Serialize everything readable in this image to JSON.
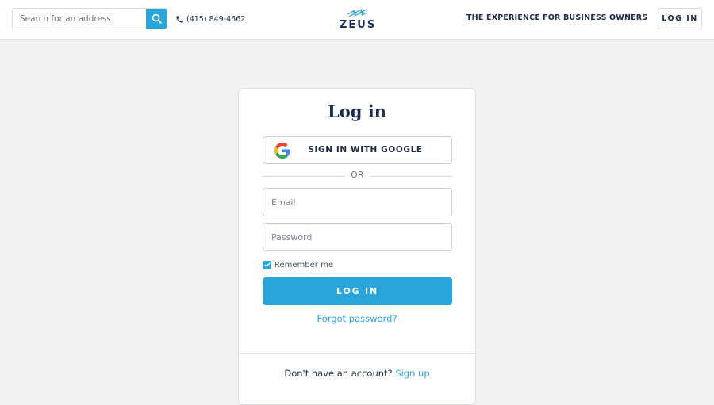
{
  "header": {
    "search": {
      "placeholder": "Search for an address",
      "icon": "search-icon"
    },
    "phone": {
      "icon": "phone-icon",
      "number": "(415) 849-4662"
    },
    "logo": {
      "text": "ZEUS"
    },
    "nav": [
      {
        "label": "THE EXPERIENCE"
      },
      {
        "label": "FOR BUSINESS"
      },
      {
        "label": "OWNERS"
      }
    ],
    "login_label": "LOG IN"
  },
  "card": {
    "title": "Log in",
    "google_label": "SIGN IN WITH GOOGLE",
    "or_label": "OR",
    "email_placeholder": "Email",
    "password_placeholder": "Password",
    "remember_label": "Remember me",
    "remember_checked": true,
    "login_label": "LOG IN",
    "forgot_label": "Forgot password?",
    "no_account_label": "Don't have an account?",
    "signup_label": "Sign up"
  },
  "colors": {
    "accent": "#2aa5dc",
    "navy": "#1b2e52",
    "background": "#f2f2f3"
  }
}
